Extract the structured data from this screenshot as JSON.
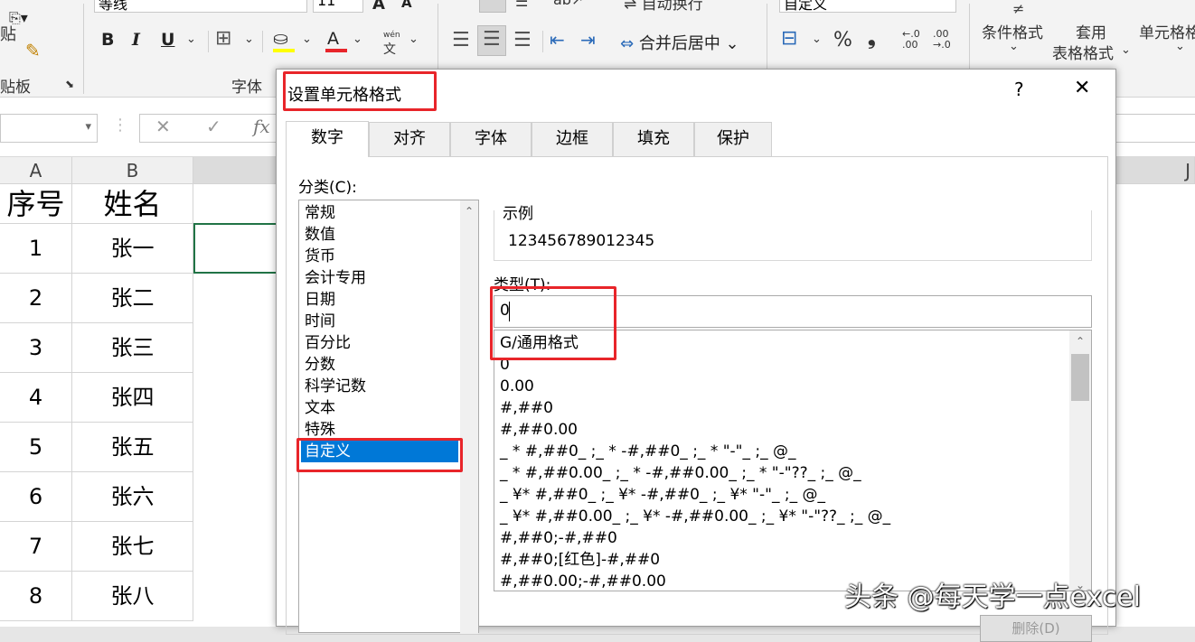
{
  "ribbon": {
    "font_name_value": "等线",
    "font_size_value": "11",
    "wrap_text_label": "自动换行",
    "number_format_value": "自定义",
    "clipboard_group": "贴板",
    "paste_label": "贴",
    "font_group": "字体",
    "merge_center_label": "合并后居中",
    "phonetic_top": "wén",
    "phonetic_bottom": "文",
    "percent": "%",
    "comma": "❟",
    "inc_decimal_top": "←.0",
    "inc_decimal_bottom": ".00",
    "dec_decimal_top": ".00",
    "dec_decimal_bottom": "→.0",
    "conditional_format_label": "条件格式",
    "table_format_label_1": "套用",
    "table_format_label_2": "表格格式",
    "cell_style_label": "单元格格",
    "bold": "B",
    "italic": "I",
    "underline": "U",
    "font_color_letter": "A",
    "grow_font": "A",
    "shrink_font": "A"
  },
  "formula_bar": {
    "cancel": "✕",
    "enter": "✓",
    "fx": "fx"
  },
  "sheet": {
    "col_a": "A",
    "col_b": "B",
    "col_j": "J",
    "header_a": "序号",
    "header_b": "姓名",
    "rows": [
      {
        "num": "1",
        "name": "张一"
      },
      {
        "num": "2",
        "name": "张二"
      },
      {
        "num": "3",
        "name": "张三"
      },
      {
        "num": "4",
        "name": "张四"
      },
      {
        "num": "5",
        "name": "张五"
      },
      {
        "num": "6",
        "name": "张六"
      },
      {
        "num": "7",
        "name": "张七"
      },
      {
        "num": "8",
        "name": "张八"
      }
    ]
  },
  "dialog": {
    "title": "设置单元格格式",
    "help": "?",
    "close": "✕",
    "tabs": [
      "数字",
      "对齐",
      "字体",
      "边框",
      "填充",
      "保护"
    ],
    "category_label": "分类(C):",
    "categories": [
      "常规",
      "数值",
      "货币",
      "会计专用",
      "日期",
      "时间",
      "百分比",
      "分数",
      "科学记数",
      "文本",
      "特殊",
      "自定义"
    ],
    "selected_category": "自定义",
    "sample_label": "示例",
    "sample_value": "123456789012345",
    "type_label": "类型(T):",
    "type_input_value": "0",
    "type_list": [
      "G/通用格式",
      "0",
      "0.00",
      "#,##0",
      "#,##0.00",
      "_ * #,##0_ ;_ * -#,##0_ ;_ * \"-\"_ ;_ @_",
      "_ * #,##0.00_ ;_ * -#,##0.00_ ;_ * \"-\"??_ ;_ @_",
      "_ ¥* #,##0_ ;_ ¥* -#,##0_ ;_ ¥* \"-\"_ ;_ @_",
      "_ ¥* #,##0.00_ ;_ ¥* -#,##0.00_ ;_ ¥* \"-\"??_ ;_ @_",
      "#,##0;-#,##0",
      "#,##0;[红色]-#,##0",
      "#,##0.00;-#,##0.00"
    ],
    "delete_button": "删除(D)"
  },
  "watermark": "头条 @每天学一点excel",
  "colors": {
    "highlight_red": "#e8252a",
    "selection_blue": "#0078d7",
    "cell_border_green": "#217346"
  }
}
